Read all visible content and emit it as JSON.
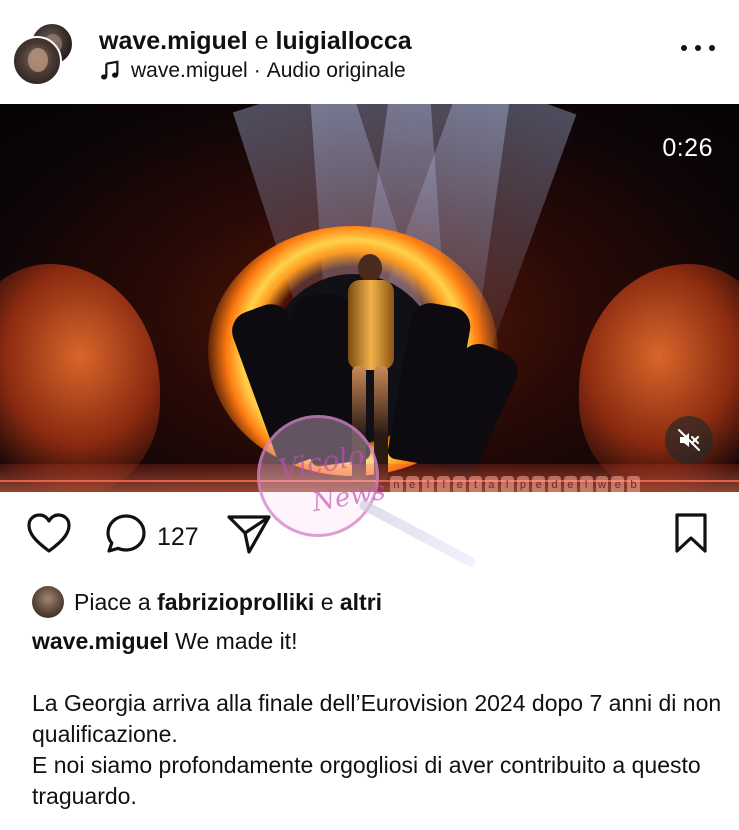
{
  "header": {
    "user_primary": "wave.miguel",
    "joiner": "e",
    "user_secondary": "luigiallocca",
    "audio_icon": "music-note-icon",
    "audio_user": "wave.miguel",
    "audio_separator": "·",
    "audio_label": "Audio originale",
    "more_icon": "more-horizontal-icon"
  },
  "video": {
    "time": "0:26",
    "mute_icon": "speaker-muted-icon",
    "stamp_line1": "Vicolo",
    "stamp_line2": "News",
    "strip_letters": [
      "n",
      "e",
      "l",
      "l",
      "e",
      " ",
      "t",
      "a",
      "l",
      "p",
      "e",
      " ",
      "d",
      "e",
      "l",
      " ",
      "w",
      "e",
      "b"
    ]
  },
  "actions": {
    "like_icon": "heart-icon",
    "comment_icon": "comment-icon",
    "comment_count": "127",
    "share_icon": "send-icon",
    "save_icon": "bookmark-icon"
  },
  "likes": {
    "prefix": "Piace a",
    "user": "fabrizioprolliki",
    "joiner": "e",
    "others": "altri"
  },
  "caption": {
    "user": "wave.miguel",
    "first_line": "We made it!",
    "para1": "La Georgia arriva alla finale dell’Eurovision 2024 dopo 7 anni di non qualificazione.",
    "para2": "E noi siamo profondamente orgogliosi di aver contribuito a questo traguardo."
  }
}
